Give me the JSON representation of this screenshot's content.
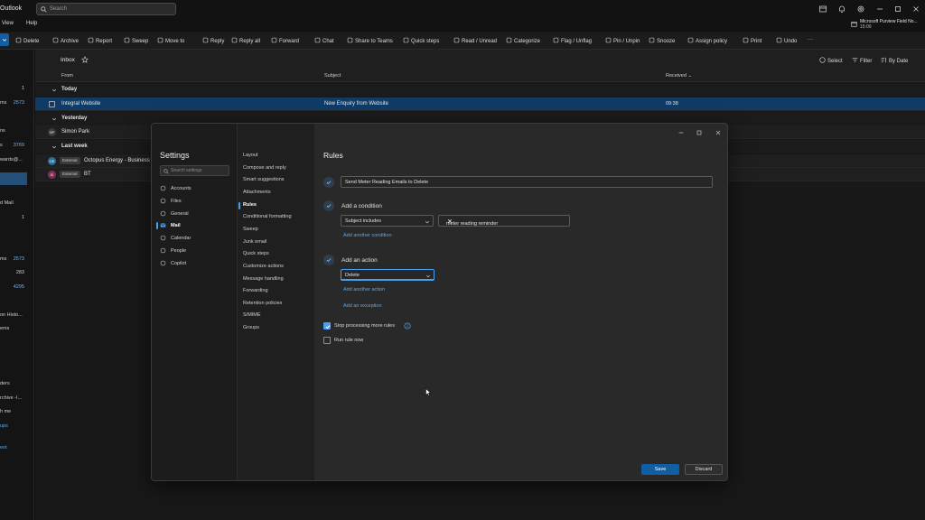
{
  "app": {
    "title": "Outlook"
  },
  "search": {
    "placeholder": "Search"
  },
  "menu": {
    "items": [
      "View",
      "Help"
    ]
  },
  "promo": {
    "title": "Microsoft Purview Field No...",
    "time": "15:00"
  },
  "ribbon": {
    "items": [
      "Delete",
      "Archive",
      "Report",
      "Sweep",
      "Move to",
      "Reply",
      "Reply all",
      "Forward",
      "Chat",
      "Share to Teams",
      "Quick steps",
      "Read / Unread",
      "Categorize",
      "Flag / Unflag",
      "Pin / Unpin",
      "Snooze",
      "Assign policy",
      "Print",
      "Undo"
    ],
    "more": "···"
  },
  "folders": {
    "items": [
      {
        "label": "",
        "count": "1",
        "count_style": "w"
      },
      {
        "label": "ms",
        "count": "2573"
      },
      {
        "label": "",
        "count": ""
      },
      {
        "label": "ns",
        "count": ""
      },
      {
        "label": "s",
        "count": "3769"
      },
      {
        "label": "wards@...",
        "count": ""
      },
      {
        "label": "d Mail",
        "count": ""
      },
      {
        "label": "",
        "count": "1",
        "count_style": "w"
      },
      {
        "label": "ms",
        "count": "2573"
      },
      {
        "label": "",
        "count": "283",
        "count_style": "w"
      },
      {
        "label": "",
        "count": "4295"
      },
      {
        "label": "on Histo...",
        "count": ""
      },
      {
        "label": "ems",
        "count": ""
      },
      {
        "label": "",
        "count": ""
      },
      {
        "label": "ders",
        "count": ""
      },
      {
        "label": "rchive -I...",
        "count": ""
      },
      {
        "label": "h me",
        "count": ""
      },
      {
        "label": "ups",
        "count": ""
      },
      {
        "label": "ent",
        "count": ""
      }
    ]
  },
  "maillist": {
    "title": "Inbox",
    "tools": {
      "select": "Select",
      "filter": "Filter",
      "sort": "By Date"
    },
    "columns": {
      "from": "From",
      "subject": "Subject",
      "received": "Received"
    },
    "groups": [
      {
        "label": "Today"
      },
      {
        "label": "Yesterday"
      },
      {
        "label": "Last week"
      }
    ],
    "rows": [
      {
        "from": "Integral Website",
        "subject": "New Enquiry from Website",
        "received": "09:38"
      },
      {
        "avatar": "SP",
        "from": "Simon Park",
        "subject": "",
        "received": ""
      },
      {
        "avatar": "OE",
        "external": "External",
        "from": "Octopus Energy - Business",
        "subject": "",
        "received": ""
      },
      {
        "avatar": "B",
        "external": "External",
        "from": "BT",
        "subject": "",
        "received": ""
      }
    ]
  },
  "settings": {
    "title": "Settings",
    "search_placeholder": "Search settings",
    "nav": [
      "Accounts",
      "Files",
      "General",
      "Mail",
      "Calendar",
      "People",
      "Copilot"
    ],
    "subnav": [
      "Layout",
      "Compose and reply",
      "Smart suggestions",
      "Attachments",
      "Rules",
      "Conditional formatting",
      "Sweep",
      "Junk email",
      "Quick steps",
      "Customize actions",
      "Message handling",
      "Forwarding",
      "Retention policies",
      "S/MIME",
      "Groups"
    ]
  },
  "rule": {
    "heading": "Rules",
    "name": "Send Meter Reading Emails to Delete",
    "condition_label": "Add a condition",
    "condition_type": "Subject includes",
    "condition_value": "meter reading reminder",
    "add_condition": "Add another condition",
    "action_label": "Add an action",
    "action_value": "Delete",
    "add_action": "Add another action",
    "add_exception": "Add an exception",
    "stop_processing": "Stop processing more rules",
    "run_now": "Run rule now",
    "save": "Save",
    "discard": "Discard"
  },
  "colors": {
    "accent": "#115ea3",
    "link": "#5aa9ee",
    "selected_row": "#0f3b66"
  }
}
